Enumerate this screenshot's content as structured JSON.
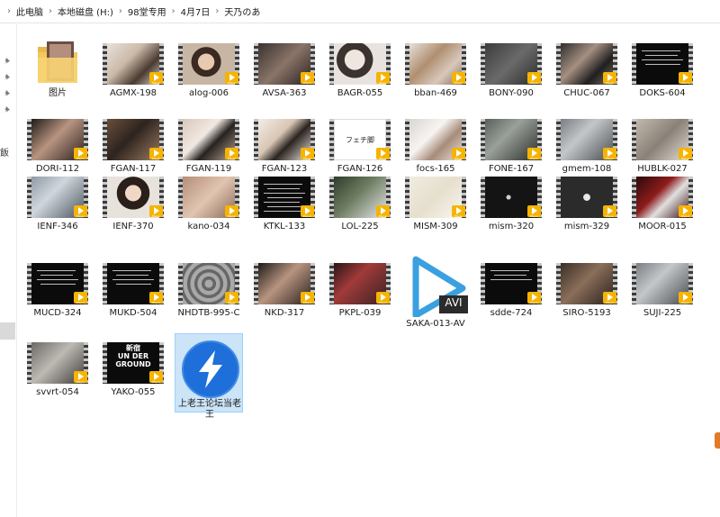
{
  "breadcrumb": [
    "此电脑",
    "本地磁盘 (H:)",
    "98堂专用",
    "4月7日",
    "天乃のあ"
  ],
  "nav": {
    "text": "飯"
  },
  "items": [
    {
      "name": "图片",
      "type": "folder"
    },
    {
      "name": "AGMX-198",
      "type": "video",
      "style": "girl-light"
    },
    {
      "name": "alog-006",
      "type": "video",
      "style": "girl-face"
    },
    {
      "name": "AVSA-363",
      "type": "video",
      "style": "dark-skin"
    },
    {
      "name": "BAGR-055",
      "type": "video",
      "style": "headphones"
    },
    {
      "name": "bban-469",
      "type": "video",
      "style": "food"
    },
    {
      "name": "BONY-090",
      "type": "video",
      "style": "dark"
    },
    {
      "name": "CHUC-067",
      "type": "video",
      "style": "legs"
    },
    {
      "name": "DOKS-604",
      "type": "video",
      "style": "text-black"
    },
    {
      "name": "DORI-112",
      "type": "video",
      "style": "skin-dark"
    },
    {
      "name": "FGAN-117",
      "type": "video",
      "style": "brown"
    },
    {
      "name": "FGAN-119",
      "type": "video",
      "style": "school"
    },
    {
      "name": "FGAN-123",
      "type": "video",
      "style": "school2"
    },
    {
      "name": "FGAN-126",
      "type": "video",
      "style": "title-card"
    },
    {
      "name": "focs-165",
      "type": "video",
      "style": "woman"
    },
    {
      "name": "FONE-167",
      "type": "video",
      "style": "street"
    },
    {
      "name": "gmem-108",
      "type": "video",
      "style": "legs-grey"
    },
    {
      "name": "HUBLK-027",
      "type": "video",
      "style": "office"
    },
    {
      "name": "IENF-346",
      "type": "video",
      "style": "outdoor"
    },
    {
      "name": "IENF-370",
      "type": "video",
      "style": "girl-bob"
    },
    {
      "name": "kano-034",
      "type": "video",
      "style": "feet"
    },
    {
      "name": "KTKL-133",
      "type": "video",
      "style": "text-black2"
    },
    {
      "name": "LOL-225",
      "type": "video",
      "style": "tree"
    },
    {
      "name": "MISM-309",
      "type": "video",
      "style": "cream"
    },
    {
      "name": "mism-320",
      "type": "video",
      "style": "dark-figure"
    },
    {
      "name": "mism-329",
      "type": "video",
      "style": "grey-figure"
    },
    {
      "name": "MOOR-015",
      "type": "video",
      "style": "red"
    },
    {
      "name": "MUCD-324",
      "type": "video",
      "style": "text-black"
    },
    {
      "name": "MUKD-504",
      "type": "video",
      "style": "text-black"
    },
    {
      "name": "NHDTB-995-C",
      "type": "video",
      "style": "grey-texture"
    },
    {
      "name": "NKD-317",
      "type": "video",
      "style": "skin-dark"
    },
    {
      "name": "PKPL-039",
      "type": "video",
      "style": "red-dark"
    },
    {
      "name": "SAKA-013-AV",
      "type": "avi",
      "ext": "AVI"
    },
    {
      "name": "sdde-724",
      "type": "video",
      "style": "text-black3"
    },
    {
      "name": "SIRO-5193",
      "type": "video",
      "style": "room"
    },
    {
      "name": "SUJI-225",
      "type": "video",
      "style": "legs-grey"
    },
    {
      "name": "svvrt-054",
      "type": "video",
      "style": "room2"
    },
    {
      "name": "YAKO-055",
      "type": "video",
      "style": "shinjuku",
      "title": "新宿\nUN DER\nGROUND"
    },
    {
      "name": "上老王论坛当老王",
      "type": "app",
      "selected": true
    }
  ],
  "colors": {
    "badge": "#f5b400",
    "avi_play": "#3aa0e0",
    "app_bg": "#1e6fd9",
    "selection_bg": "#cce4f7"
  }
}
